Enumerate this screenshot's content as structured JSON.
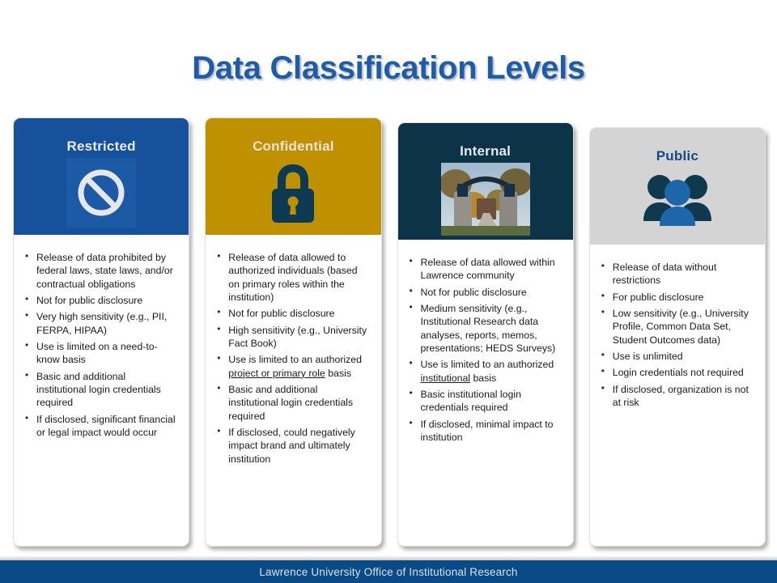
{
  "slide": {
    "title": "Data Classification Levels",
    "title_color": "#1f5ca8",
    "footer": "Lawrence University  Office of Institutional  Research",
    "footer_bar_color": "#0a4a86"
  },
  "columns": [
    {
      "id": "restricted",
      "title": "Restricted",
      "header_color": "#17519b",
      "title_color": "#e8e9ea",
      "icon": "prohibited-icon",
      "bullets": [
        "Release of data prohibited by federal laws, state laws, and/or contractual obligations",
        "Not for public disclosure",
        "Very high sensitivity (e.g., PII, FERPA, HIPAA)",
        "Use is limited on a need-to-know basis",
        "Basic and additional institutional login credentials required",
        "If disclosed, significant financial or legal impact would occur"
      ]
    },
    {
      "id": "confidential",
      "title": "Confidential",
      "header_color": "#bf9000",
      "title_color": "#e9e4d6",
      "icon": "padlock-icon",
      "bullets": [
        "Release of data allowed to authorized individuals (based on primary roles within the institution)",
        "Not for public disclosure",
        "High sensitivity (e.g., University Fact Book)",
        "Use is limited to an authorized <u>project or primary role</u> basis",
        "Basic and additional institutional login credentials required",
        "If disclosed, could negatively impact brand and ultimately institution"
      ]
    },
    {
      "id": "internal",
      "title": "Internal",
      "header_color": "#0d3348",
      "title_color": "#e6e8ea",
      "icon": "campus-gate-photo",
      "bullets": [
        "Release of data allowed within Lawrence community",
        "Not for public disclosure",
        "Medium sensitivity (e.g., Institutional Research data analyses, reports, memos, presentations; HEDS Surveys)",
        "Use is limited to an authorized <u>institutional</u> basis",
        "Basic institutional login credentials required",
        "If disclosed, minimal impact to institution"
      ]
    },
    {
      "id": "public",
      "title": "Public",
      "header_color": "#d4d4d4",
      "title_color": "#174a86",
      "icon": "people-group-icon",
      "bullets": [
        "Release of data without restrictions",
        "For public disclosure",
        "Low sensitivity (e.g., University Profile, Common Data Set, Student Outcomes data)",
        "Use is unlimited",
        "Login credentials not required",
        "If disclosed, organization is not at risk"
      ]
    }
  ]
}
